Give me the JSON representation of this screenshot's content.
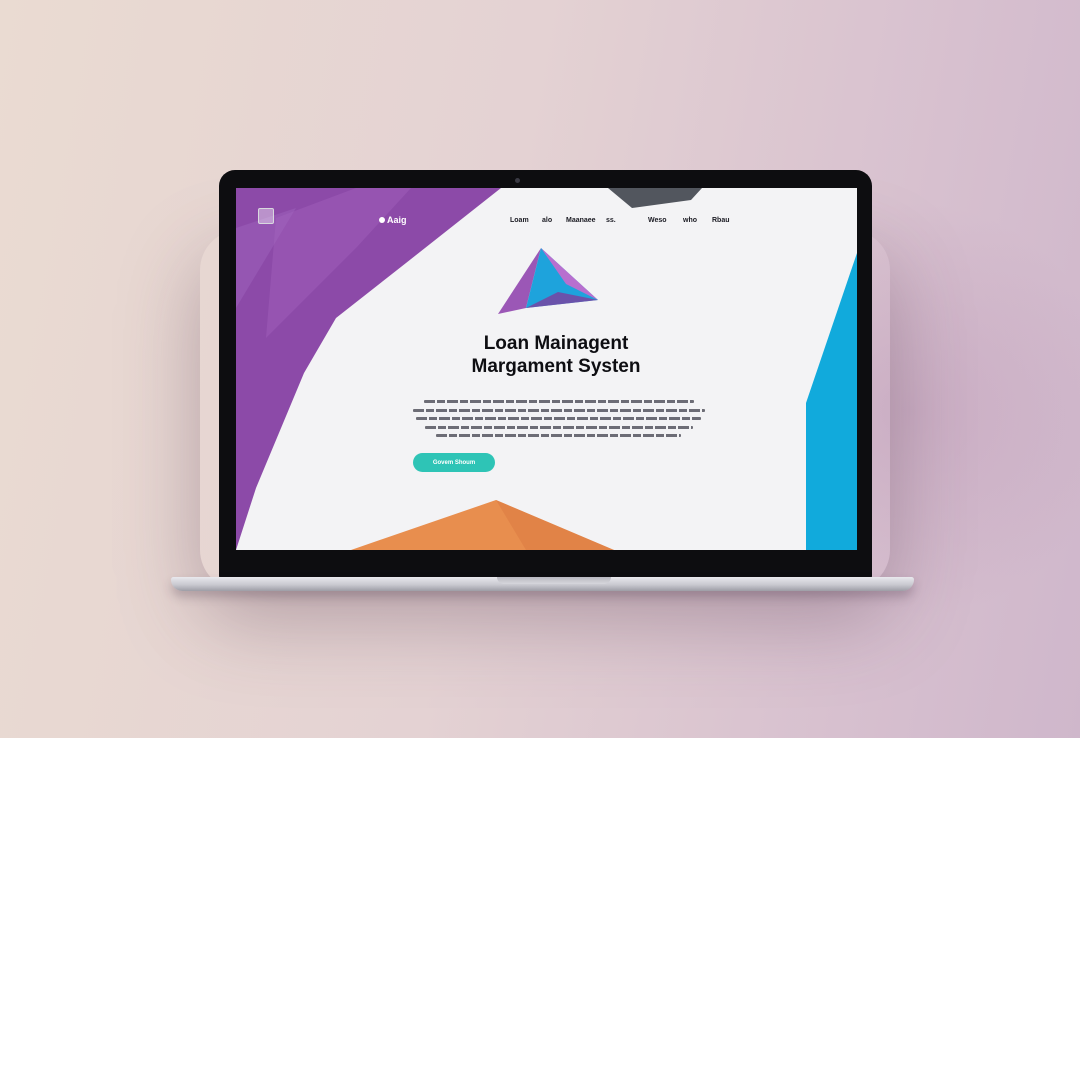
{
  "brand": {
    "name": "Aaig"
  },
  "nav": {
    "items": [
      {
        "label": "Loam"
      },
      {
        "label": "alo"
      },
      {
        "label": "Maanaee"
      },
      {
        "label": "ss."
      },
      {
        "label": "Weso"
      },
      {
        "label": "who"
      },
      {
        "label": "Rbau"
      }
    ]
  },
  "hero": {
    "title_line1": "Loan Mainagent",
    "title_line2": "Margament Systen",
    "cta_label": "Govem Shoum"
  },
  "colors": {
    "purple": "#8c4aa8",
    "teal_cta": "#2ec4b6",
    "blue": "#11aadc",
    "orange": "#e88e4e",
    "dark": "#0e0e12"
  }
}
